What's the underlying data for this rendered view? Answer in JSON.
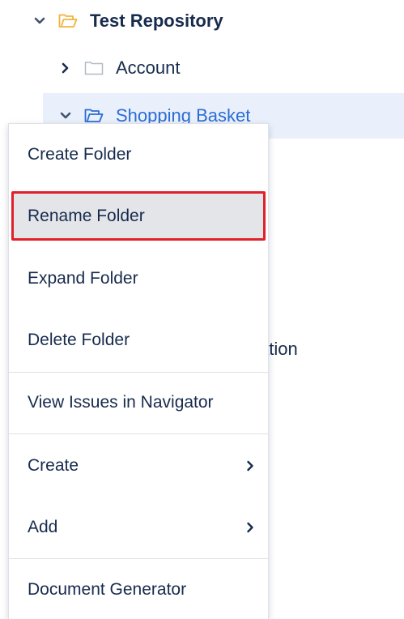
{
  "colors": {
    "accent": "#2b6cd4",
    "selected_row_bg": "#e9f0fb",
    "folder_root": "#f2b33d",
    "highlight_border": "#e0202b",
    "highlight_bg": "#e4e5e9"
  },
  "tree": {
    "root": {
      "label": "Test Repository",
      "chevron": "chevron-down-icon",
      "icon": "folder-open-icon"
    },
    "items": [
      {
        "label": "Account",
        "chevron": "chevron-right-icon",
        "icon": "folder-icon"
      },
      {
        "label": "Shopping Basket",
        "chevron": "chevron-down-icon",
        "icon": "folder-open-icon",
        "selected": true
      }
    ],
    "partially_hidden_text": "ation"
  },
  "context_menu": {
    "items": [
      {
        "label": "Create Folder"
      },
      {
        "label": "Rename Folder",
        "highlighted": true
      },
      {
        "label": "Expand Folder"
      },
      {
        "label": "Delete Folder"
      },
      {
        "label": "View Issues in Navigator"
      },
      {
        "label": "Create",
        "submenu_icon": "chevron-right-icon"
      },
      {
        "label": "Add",
        "submenu_icon": "chevron-right-icon"
      },
      {
        "label": "Document Generator"
      }
    ]
  }
}
